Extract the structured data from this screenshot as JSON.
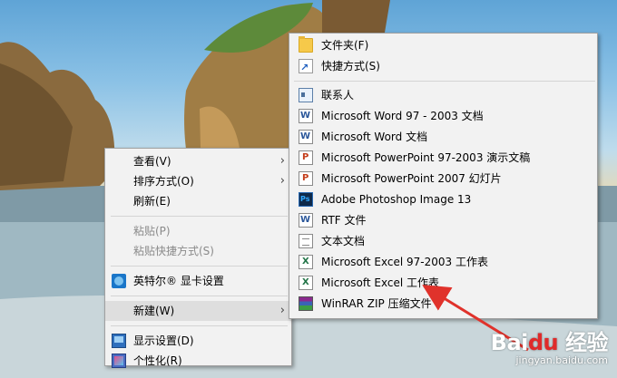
{
  "main_menu": {
    "items": [
      {
        "label": "查看(V)",
        "submenu": true
      },
      {
        "label": "排序方式(O)",
        "submenu": true
      },
      {
        "label": "刷新(E)"
      },
      {
        "label": "粘贴(P)",
        "disabled": true
      },
      {
        "label": "粘贴快捷方式(S)",
        "disabled": true
      },
      {
        "label": "英特尔® 显卡设置",
        "icon": "intel-graphics-icon"
      },
      {
        "label": "新建(W)",
        "submenu": true,
        "highlighted": true
      },
      {
        "label": "显示设置(D)",
        "icon": "display-settings-icon"
      },
      {
        "label": "个性化(R)",
        "icon": "personalize-icon"
      }
    ]
  },
  "new_submenu": {
    "items": [
      {
        "label": "文件夹(F)",
        "icon": "folder-icon"
      },
      {
        "label": "快捷方式(S)",
        "icon": "shortcut-icon"
      },
      {
        "label": "联系人",
        "icon": "contact-icon"
      },
      {
        "label": "Microsoft Word 97 - 2003 文档",
        "icon": "word-icon"
      },
      {
        "label": "Microsoft Word 文档",
        "icon": "word-icon"
      },
      {
        "label": "Microsoft PowerPoint 97-2003 演示文稿",
        "icon": "powerpoint-icon"
      },
      {
        "label": "Microsoft PowerPoint 2007 幻灯片",
        "icon": "powerpoint-icon"
      },
      {
        "label": "Adobe Photoshop Image 13",
        "icon": "photoshop-icon"
      },
      {
        "label": "RTF 文件",
        "icon": "word-icon"
      },
      {
        "label": "文本文档",
        "icon": "text-document-icon"
      },
      {
        "label": "Microsoft Excel 97-2003 工作表",
        "icon": "excel-icon"
      },
      {
        "label": "Microsoft Excel 工作表",
        "icon": "excel-icon",
        "annotated": true
      },
      {
        "label": "WinRAR ZIP 压缩文件",
        "icon": "winrar-icon"
      }
    ]
  },
  "watermark": {
    "logo_a": "Bai",
    "logo_b": "du",
    "logo_c": "经验",
    "url": "jingyan.baidu.com"
  },
  "colors": {
    "menu_bg": "#f2f2f2",
    "highlight_bg": "#dedede",
    "annotation_arrow": "#e0322b"
  }
}
